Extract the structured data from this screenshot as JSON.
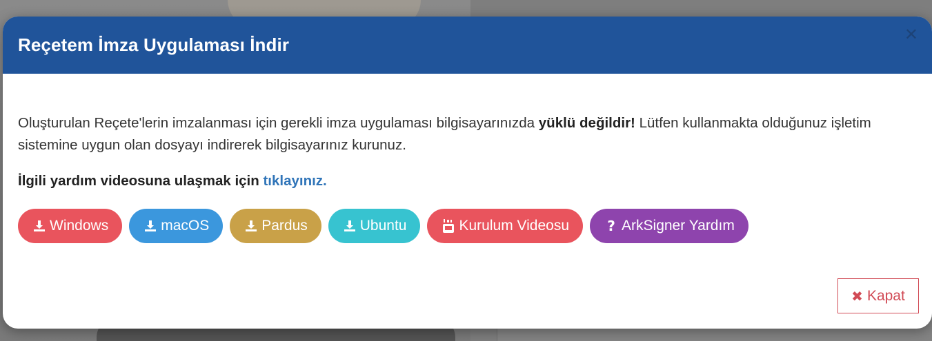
{
  "modal": {
    "title": "Reçetem İmza Uygulaması İndir",
    "close_icon": "close-icon",
    "description_part1": "Oluşturulan Reçete'lerin imzalanması için gerekli imza uygulaması bilgisayarınızda ",
    "description_bold": "yüklü değildir!",
    "description_part2": " Lütfen kullanmakta olduğunuz işletim sistemine uygun olan dosyayı indirerek bilgisayarınız kurunuz.",
    "help_text": "İlgili yardım videosuna ulaşmak için ",
    "help_link": "tıklayınız.",
    "buttons": [
      {
        "label": "Windows",
        "icon": "download-icon",
        "color": "#e9545d"
      },
      {
        "label": "macOS",
        "icon": "download-icon",
        "color": "#3b97dd"
      },
      {
        "label": "Pardus",
        "icon": "download-icon",
        "color": "#c9a148"
      },
      {
        "label": "Ubuntu",
        "icon": "download-icon",
        "color": "#37c3d0"
      },
      {
        "label": "Kurulum Videosu",
        "icon": "youtube-icon",
        "color": "#e9545d"
      },
      {
        "label": "ArkSigner Yardım",
        "icon": "question-icon",
        "color": "#8e44ad"
      }
    ],
    "close_button": {
      "label": "Kapat",
      "icon": "times-icon",
      "color": "#d14a55"
    }
  },
  "colors": {
    "header": "#20549a",
    "link": "#2f74b8"
  }
}
